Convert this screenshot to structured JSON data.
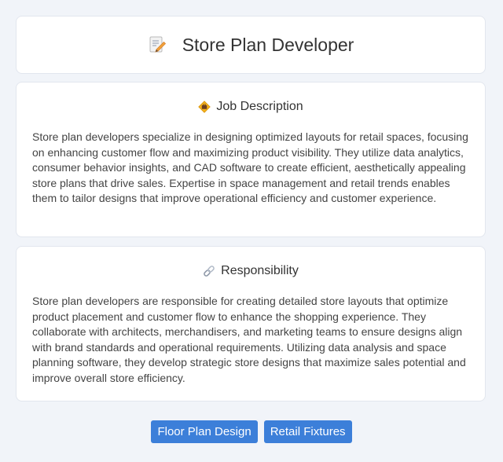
{
  "header": {
    "title": "Store Plan Developer",
    "icon": "memo-pencil-icon"
  },
  "job_description": {
    "heading": "Job Description",
    "icon": "briefcase-diamond-icon",
    "text": "Store plan developers specialize in designing optimized layouts for retail spaces, focusing on enhancing customer flow and maximizing product visibility. They utilize data analytics, consumer behavior insights, and CAD software to create efficient, aesthetically appealing store plans that drive sales. Expertise in space management and retail trends enables them to tailor designs that improve operational efficiency and customer experience."
  },
  "responsibility": {
    "heading": "Responsibility",
    "icon": "link-icon",
    "text": "Store plan developers are responsible for creating detailed store layouts that optimize product placement and customer flow to enhance the shopping experience. They collaborate with architects, merchandisers, and marketing teams to ensure designs align with brand standards and operational requirements. Utilizing data analysis and space planning software, they develop strategic store designs that maximize sales potential and improve overall store efficiency."
  },
  "tags": [
    {
      "label": "Floor Plan Design"
    },
    {
      "label": "Retail Fixtures"
    }
  ],
  "colors": {
    "background": "#f1f4f9",
    "card": "#ffffff",
    "tag": "#3c7fd9"
  }
}
